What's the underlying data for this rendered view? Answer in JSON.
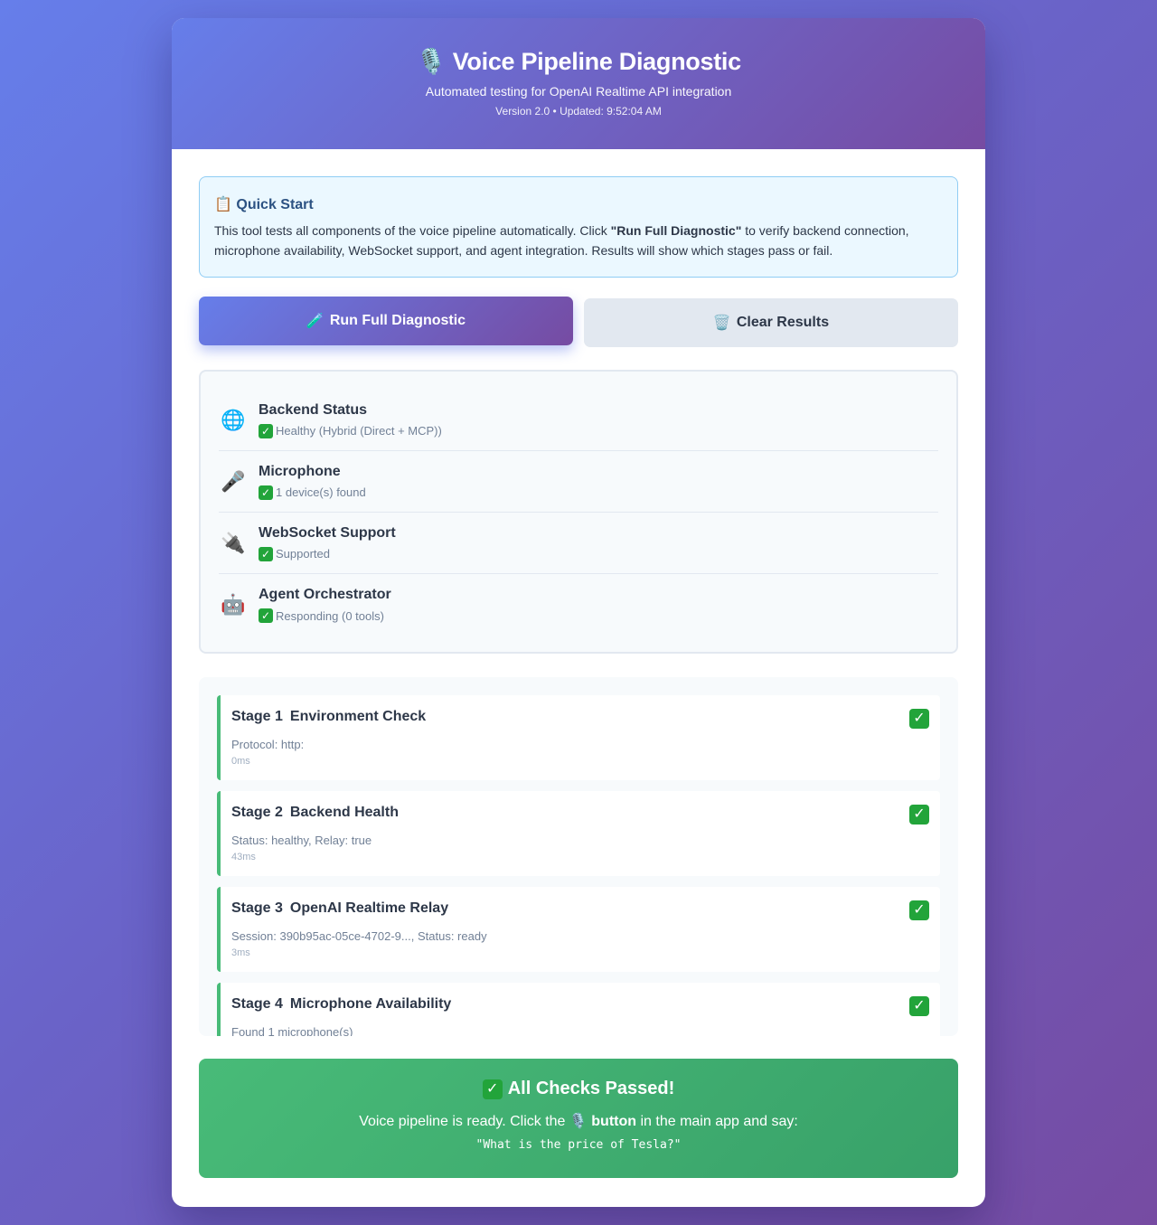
{
  "header": {
    "icon": "🎙️",
    "title": "Voice Pipeline Diagnostic",
    "subtitle": "Automated testing for OpenAI Realtime API integration",
    "version": "Version 2.0 • Updated: 9:52:04 AM"
  },
  "quick_start": {
    "icon": "📋",
    "title": "Quick Start",
    "text_before": "This tool tests all components of the voice pipeline automatically. Click ",
    "text_bold": "\"Run Full Diagnostic\"",
    "text_after": " to verify backend connection, microphone availability, WebSocket support, and agent integration. Results will show which stages pass or fail."
  },
  "actions": {
    "run_icon": "🧪",
    "run_label": "Run Full Diagnostic",
    "clear_icon": "🗑️",
    "clear_label": "Clear Results"
  },
  "status_items": [
    {
      "icon": "🌐",
      "icon_name": "globe-icon",
      "name": "Backend Status",
      "value": "Healthy (Hybrid (Direct + MCP))"
    },
    {
      "icon": "🎤",
      "icon_name": "microphone-icon",
      "name": "Microphone",
      "value": "1 device(s) found"
    },
    {
      "icon": "🔌",
      "icon_name": "plug-icon",
      "name": "WebSocket Support",
      "value": "Supported"
    },
    {
      "icon": "🤖",
      "icon_name": "robot-icon",
      "name": "Agent Orchestrator",
      "value": "Responding (0 tools)"
    }
  ],
  "stages": [
    {
      "num": "Stage 1",
      "name": "Environment Check",
      "detail": "Protocol: http:",
      "time": "0ms"
    },
    {
      "num": "Stage 2",
      "name": "Backend Health",
      "detail": "Status: healthy, Relay: true",
      "time": "43ms"
    },
    {
      "num": "Stage 3",
      "name": "OpenAI Realtime Relay",
      "detail": "Session: 390b95ac-05ce-4702-9..., Status: ready",
      "time": "3ms"
    },
    {
      "num": "Stage 4",
      "name": "Microphone Availability",
      "detail": "Found 1 microphone(s)",
      "time": ""
    }
  ],
  "success": {
    "title": "All Checks Passed!",
    "text_before": "Voice pipeline is ready. Click the ",
    "button_icon": "🎙️",
    "button_word": "button",
    "text_after": " in the main app and say:",
    "example": "\"What is the price of Tesla?\""
  },
  "colors": {
    "gradient_start": "#667eea",
    "gradient_end": "#764ba2",
    "success": "#48bb78",
    "check": "#22a43a"
  }
}
